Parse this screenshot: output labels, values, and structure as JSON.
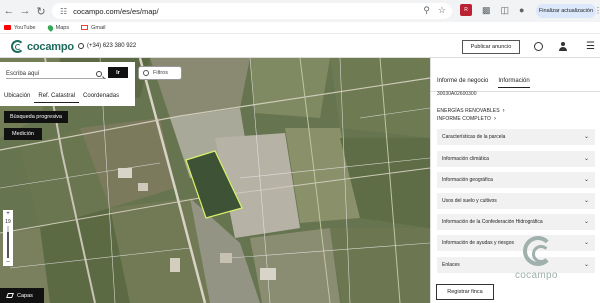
{
  "browser": {
    "url": "cocampo.com/es/es/map/",
    "update_label": "Finalizar actualización",
    "bookmarks": [
      "YouTube",
      "Maps",
      "Gmail"
    ]
  },
  "header": {
    "logo_text": "cocampo",
    "phone": "(+34) 623 380 922",
    "publish_label": "Publicar anuncio"
  },
  "search": {
    "placeholder": "Escriba aquí",
    "go_label": "Ir",
    "tabs": [
      "Ubicación",
      "Ref. Catastral",
      "Coordenadas"
    ],
    "active_tab": "Ref. Catastral"
  },
  "map": {
    "progressive_search_label": "Búsqueda progresiva",
    "measure_label": "Medición",
    "filters_label": "Filtros",
    "zoom_level": "19",
    "layers_label": "Capas"
  },
  "panel": {
    "tabs": [
      "Informe de negocio",
      "Información"
    ],
    "active_tab": "Información",
    "ref_code": "30030A02600300",
    "links": [
      "ENERGÍAS RENOVABLES",
      "INFORME COMPLETO"
    ],
    "sections": [
      "Características de la parcela",
      "Información climática",
      "Información geográfica",
      "Usos del suelo y cultivos",
      "Información de la Confederación Hidrográfica",
      "Información de ayudas y riesgos",
      "Enlaces"
    ],
    "register_label": "Registrar finca",
    "watermark_text": "cocampo"
  },
  "colors": {
    "brand": "#1e6b5c",
    "parcel_highlight": "#d9f26a"
  }
}
